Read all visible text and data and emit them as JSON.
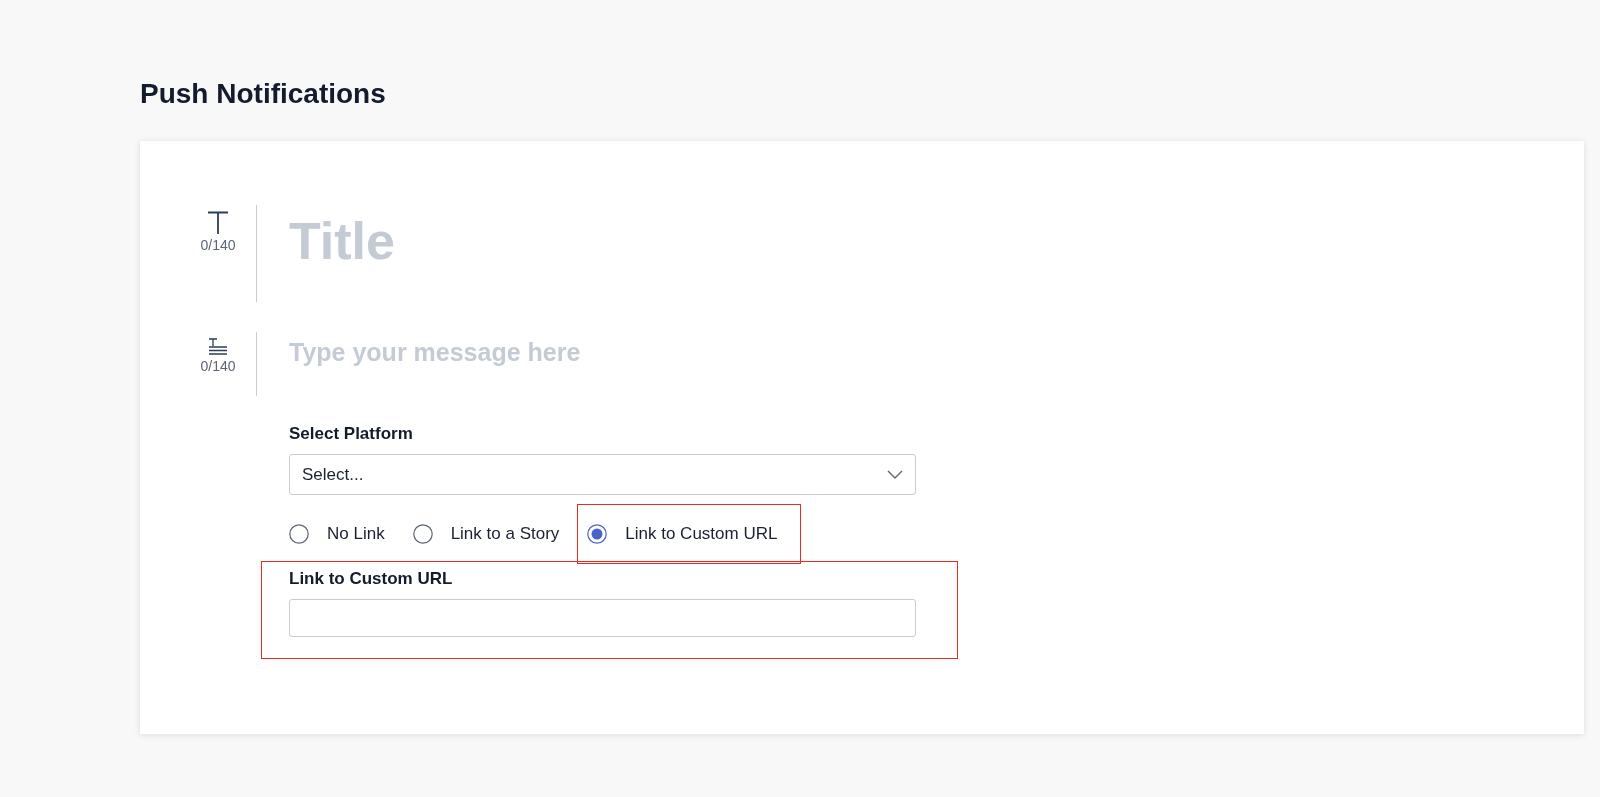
{
  "page": {
    "title": "Push Notifications"
  },
  "title_field": {
    "placeholder": "Title",
    "counter": "0/140"
  },
  "message_field": {
    "placeholder": "Type your message here",
    "counter": "0/140"
  },
  "platform": {
    "label": "Select Platform",
    "placeholder": "Select..."
  },
  "link_options": [
    {
      "label": "No Link",
      "selected": false
    },
    {
      "label": "Link to a Story",
      "selected": false
    },
    {
      "label": "Link to Custom URL",
      "selected": true
    }
  ],
  "url_field": {
    "label": "Link to Custom URL"
  }
}
